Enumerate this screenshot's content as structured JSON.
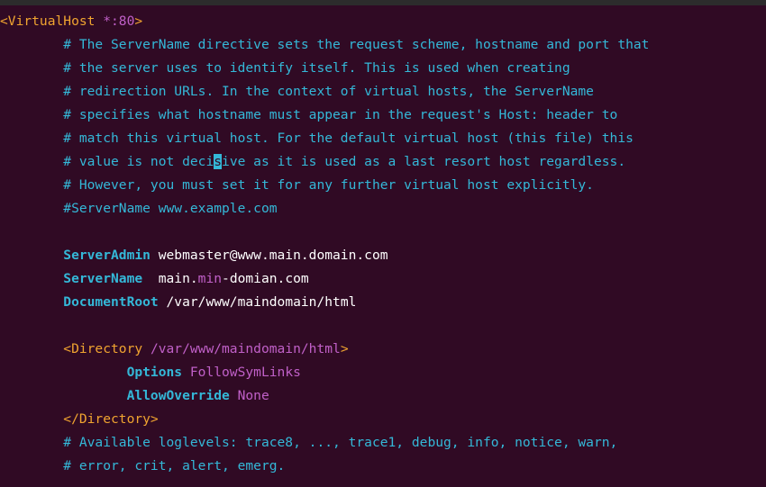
{
  "editor": {
    "lines": [
      {
        "segments": [
          {
            "t": "<VirtualHost",
            "c": "tag"
          },
          {
            "t": " *:80",
            "c": "tagattr"
          },
          {
            "t": ">",
            "c": "tag"
          }
        ]
      },
      {
        "segments": [
          {
            "t": "        # The ServerName directive sets the request scheme, hostname and port that",
            "c": "comment"
          }
        ]
      },
      {
        "segments": [
          {
            "t": "        # the server uses to identify itself. This is used when creating",
            "c": "comment"
          }
        ]
      },
      {
        "segments": [
          {
            "t": "        # redirection URLs. In the context of virtual hosts, the ServerName",
            "c": "comment"
          }
        ]
      },
      {
        "segments": [
          {
            "t": "        # specifies what hostname must appear in the request's Host: header to",
            "c": "comment"
          }
        ]
      },
      {
        "segments": [
          {
            "t": "        # match this virtual host. For the default virtual host (this file) this",
            "c": "comment"
          }
        ]
      },
      {
        "segments": [
          {
            "t": "        # value is not deci",
            "c": "comment"
          },
          {
            "t": "s",
            "c": "cursor"
          },
          {
            "t": "ive as it is used as a last resort host regardless.",
            "c": "comment"
          }
        ]
      },
      {
        "segments": [
          {
            "t": "        # However, you must set it for any further virtual host explicitly.",
            "c": "comment"
          }
        ]
      },
      {
        "segments": [
          {
            "t": "        #ServerName www.example.com",
            "c": "comment"
          }
        ]
      },
      {
        "segments": []
      },
      {
        "segments": [
          {
            "t": "        ServerAdmin",
            "c": "key"
          },
          {
            "t": " webmaster@www.main.domain.com",
            "c": "text"
          }
        ]
      },
      {
        "segments": [
          {
            "t": "        ServerName",
            "c": "key"
          },
          {
            "t": "  main.",
            "c": "text"
          },
          {
            "t": "min",
            "c": "purple"
          },
          {
            "t": "-domian.com",
            "c": "text"
          }
        ]
      },
      {
        "segments": [
          {
            "t": "        DocumentRoot",
            "c": "key"
          },
          {
            "t": " /var/www/maindomain/html",
            "c": "text"
          }
        ]
      },
      {
        "segments": []
      },
      {
        "segments": [
          {
            "t": "        <Directory",
            "c": "tag"
          },
          {
            "t": " /var/www/maindomain/html",
            "c": "tagattr"
          },
          {
            "t": ">",
            "c": "tag"
          }
        ]
      },
      {
        "segments": [
          {
            "t": "                Options",
            "c": "key"
          },
          {
            "t": " FollowSymLinks",
            "c": "purple"
          }
        ]
      },
      {
        "segments": [
          {
            "t": "                AllowOverride",
            "c": "key"
          },
          {
            "t": " None",
            "c": "purple"
          }
        ]
      },
      {
        "segments": [
          {
            "t": "        </Directory>",
            "c": "tag"
          }
        ]
      },
      {
        "segments": [
          {
            "t": "        # Available loglevels: trace8, ..., trace1, debug, info, notice, warn,",
            "c": "comment"
          }
        ]
      },
      {
        "segments": [
          {
            "t": "        # error, crit, alert, emerg.",
            "c": "comment"
          }
        ]
      }
    ]
  }
}
